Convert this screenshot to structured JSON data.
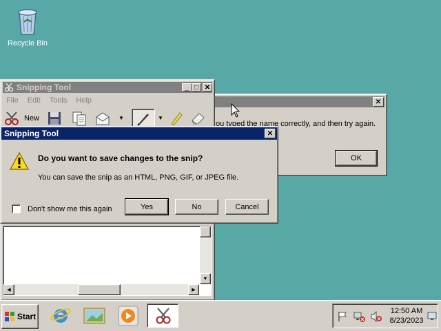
{
  "desktop": {
    "recycle_bin_label": "Recycle Bin"
  },
  "error_dialog": {
    "title": "",
    "message_fragment": "ou typed the name correctly, and then try again.",
    "ok_label": "OK"
  },
  "snipping_tool": {
    "title": "Snipping Tool",
    "menu": [
      "File",
      "Edit",
      "Tools",
      "Help"
    ],
    "new_label": "New"
  },
  "save_dialog": {
    "title": "Snipping Tool",
    "heading": "Do you want to save changes to the snip?",
    "body": "You can save the snip as an HTML, PNG, GIF, or JPEG file.",
    "checkbox_label": "Don't show me this again",
    "yes_label": "Yes",
    "no_label": "No",
    "cancel_label": "Cancel"
  },
  "taskbar": {
    "start_label": "Start",
    "clock_time": "12:50 AM",
    "clock_date": "8/23/2023"
  },
  "colors": {
    "desktop": "#58a8a8",
    "active_title": "#0a246a",
    "inactive_title": "#808080",
    "face": "#d4d0c8"
  }
}
